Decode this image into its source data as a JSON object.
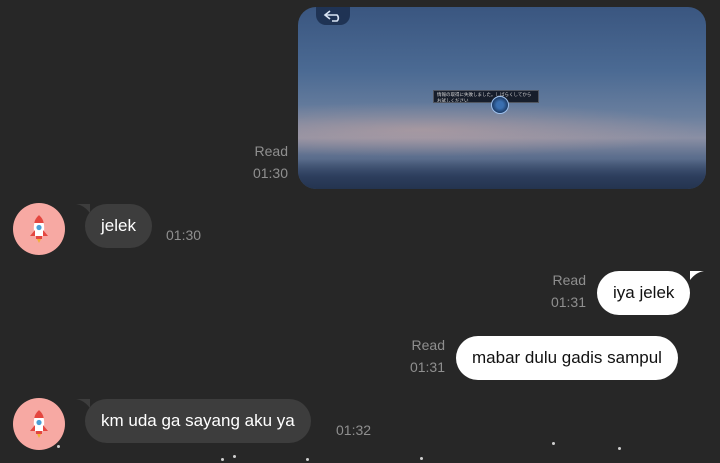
{
  "messages": [
    {
      "type": "image",
      "direction": "out",
      "read_label": "Read",
      "time": "01:30",
      "image_dialog_text": "情報の取得に失敗しました。しばらくしてからお試しください"
    },
    {
      "type": "text",
      "direction": "in",
      "text": "jelek",
      "time": "01:30"
    },
    {
      "type": "text",
      "direction": "out",
      "text": "iya jelek",
      "read_label": "Read",
      "time": "01:31"
    },
    {
      "type": "text",
      "direction": "out",
      "text": "mabar dulu gadis sampul",
      "read_label": "Read",
      "time": "01:31"
    },
    {
      "type": "text",
      "direction": "in",
      "text": "km uda ga sayang aku ya",
      "time": "01:32"
    }
  ],
  "colors": {
    "background": "#272727",
    "incoming_bubble": "#3d3d3d",
    "outgoing_bubble": "#ffffff",
    "avatar_bg": "#f7a9a3",
    "meta_text": "#8f8f8f"
  },
  "icons": {
    "avatar": "rocket-icon",
    "image_back": "back-arrow-icon",
    "image_loader": "loading-icon"
  }
}
